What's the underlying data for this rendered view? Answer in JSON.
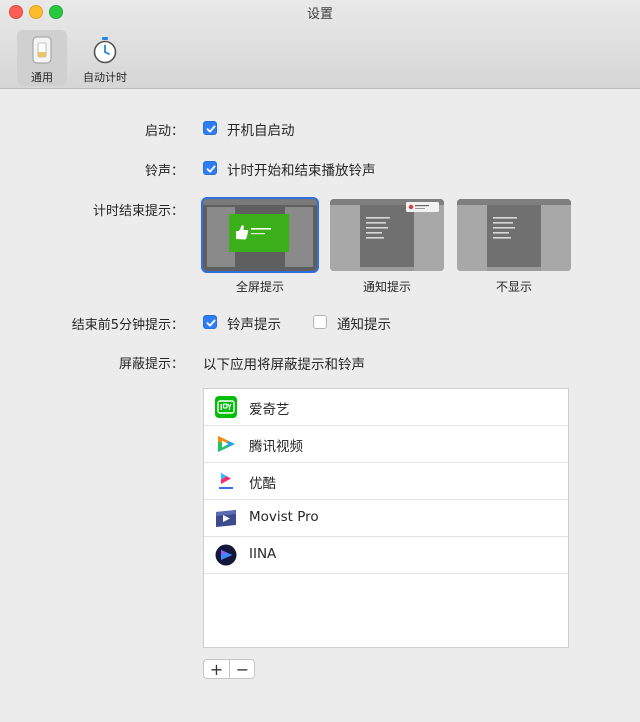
{
  "window": {
    "title": "设置"
  },
  "toolbar": {
    "items": [
      {
        "label": "通用",
        "icon": "phone-icon",
        "selected": true
      },
      {
        "label": "自动计时",
        "icon": "stopwatch-icon",
        "selected": false
      }
    ]
  },
  "general": {
    "startup": {
      "label": "启动：",
      "checkbox_label": "开机自启动",
      "checked": true
    },
    "ringtone": {
      "label": "铃声：",
      "checkbox_label": "计时开始和结束播放铃声",
      "checked": true
    },
    "end_alert": {
      "label": "计时结束提示：",
      "options": [
        {
          "label": "全屏提示",
          "selected": true
        },
        {
          "label": "通知提示",
          "selected": false
        },
        {
          "label": "不显示",
          "selected": false
        }
      ]
    },
    "five_min_alert": {
      "label": "结束前5分钟提示：",
      "options": [
        {
          "label": "铃声提示",
          "checked": true
        },
        {
          "label": "通知提示",
          "checked": false
        }
      ]
    },
    "block": {
      "label": "屏蔽提示：",
      "description": "以下应用将屏蔽提示和铃声",
      "apps": [
        {
          "name": "爱奇艺",
          "icon": "iqiyi-icon"
        },
        {
          "name": "腾讯视频",
          "icon": "tencent-video-icon"
        },
        {
          "name": "优酷",
          "icon": "youku-icon"
        },
        {
          "name": "Movist Pro",
          "icon": "movist-icon"
        },
        {
          "name": "IINA",
          "icon": "iina-icon"
        }
      ],
      "add_label": "+",
      "remove_label": "−"
    }
  },
  "colors": {
    "accent": "#2f7df6",
    "window_bg": "#ececec",
    "preview_green": "#3bb01a"
  }
}
